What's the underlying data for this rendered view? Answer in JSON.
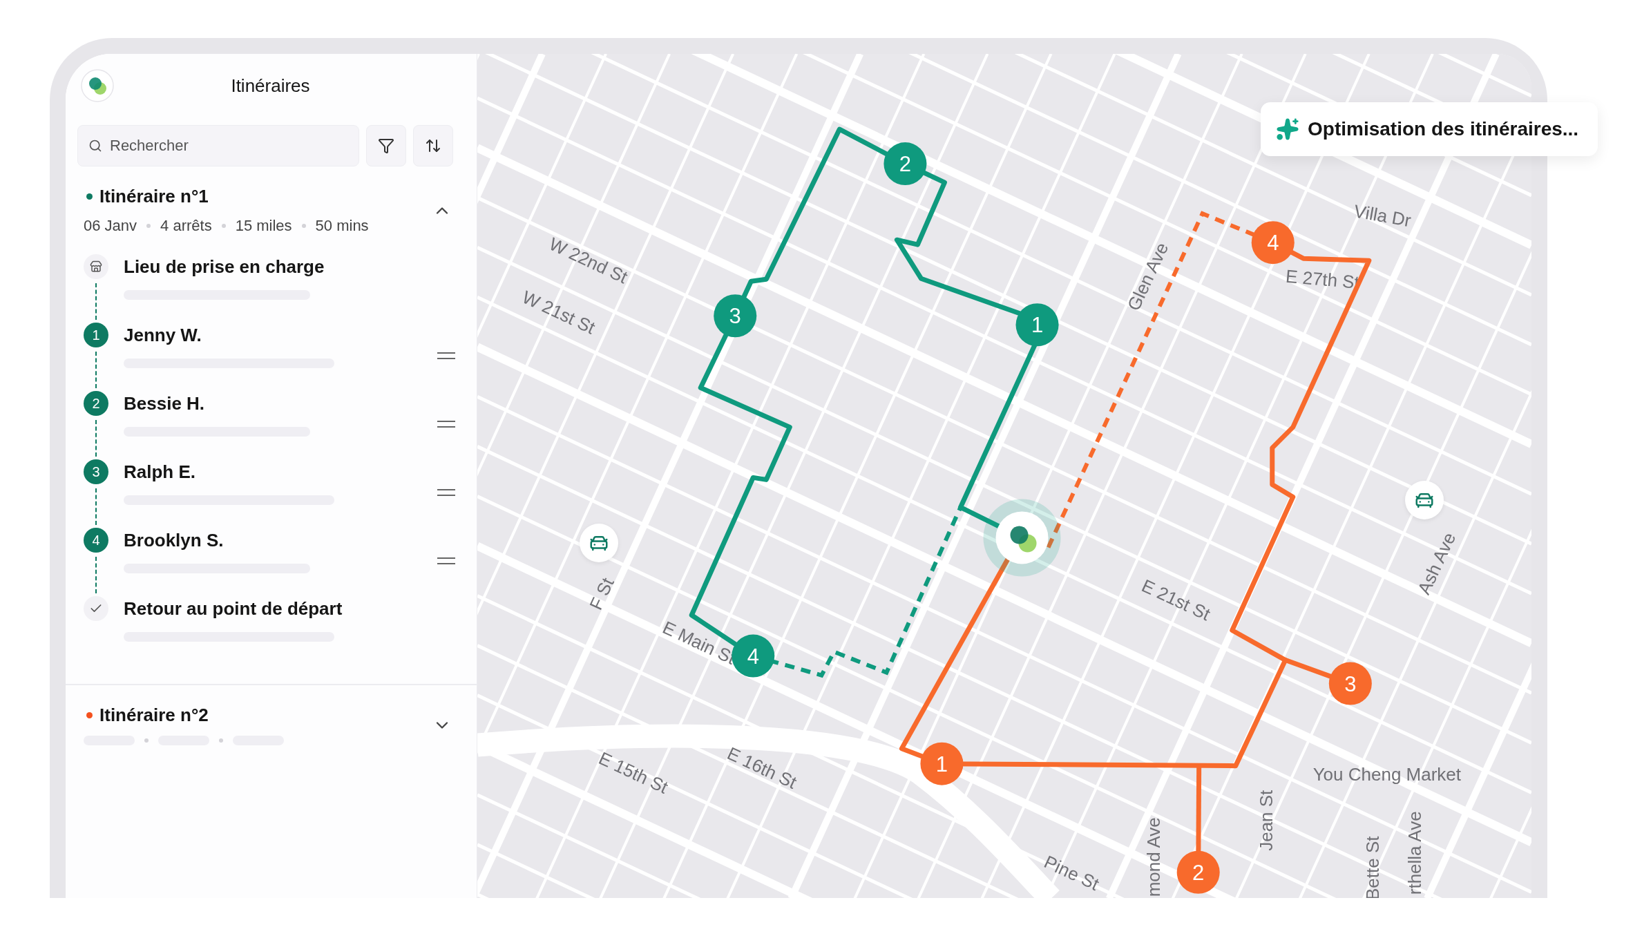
{
  "sidebar": {
    "title": "Itinéraires",
    "search": {
      "placeholder": "Rechercher"
    },
    "routes": [
      {
        "name": "Itinéraire n°1",
        "color": "#0e7a62",
        "expanded": true,
        "meta": [
          "06 Janv",
          "4 arrêts",
          "15 miles",
          "50 mins"
        ],
        "stops": [
          {
            "kind": "pickup",
            "name": "Lieu de prise en charge"
          },
          {
            "kind": "numbered",
            "number": "1",
            "name": "Jenny W."
          },
          {
            "kind": "numbered",
            "number": "2",
            "name": "Bessie H."
          },
          {
            "kind": "numbered",
            "number": "3",
            "name": "Ralph E."
          },
          {
            "kind": "numbered",
            "number": "4",
            "name": "Brooklyn S."
          },
          {
            "kind": "return",
            "name": "Retour au point de départ"
          }
        ]
      },
      {
        "name": "Itinéraire n°2",
        "color": "#f4511e",
        "expanded": false
      }
    ]
  },
  "map": {
    "banner": "Optimisation des itinéraires...",
    "street_labels": [
      "W 22nd St",
      "W 21st St",
      "F St",
      "E Main St",
      "E 15th St",
      "E 16th St",
      "E 21st St",
      "Glen Ave",
      "Villa Dr",
      "E 27th St",
      "Ash Ave",
      "You Cheng Market",
      "Pine St",
      "mond Ave",
      "Jean St",
      "Bette St",
      "rthella Ave"
    ],
    "routes": [
      {
        "color": "#0f9a7e",
        "stops": [
          "1",
          "2",
          "3",
          "4"
        ]
      },
      {
        "color": "#f86a2c",
        "stops": [
          "1",
          "2",
          "3",
          "4"
        ]
      }
    ]
  }
}
